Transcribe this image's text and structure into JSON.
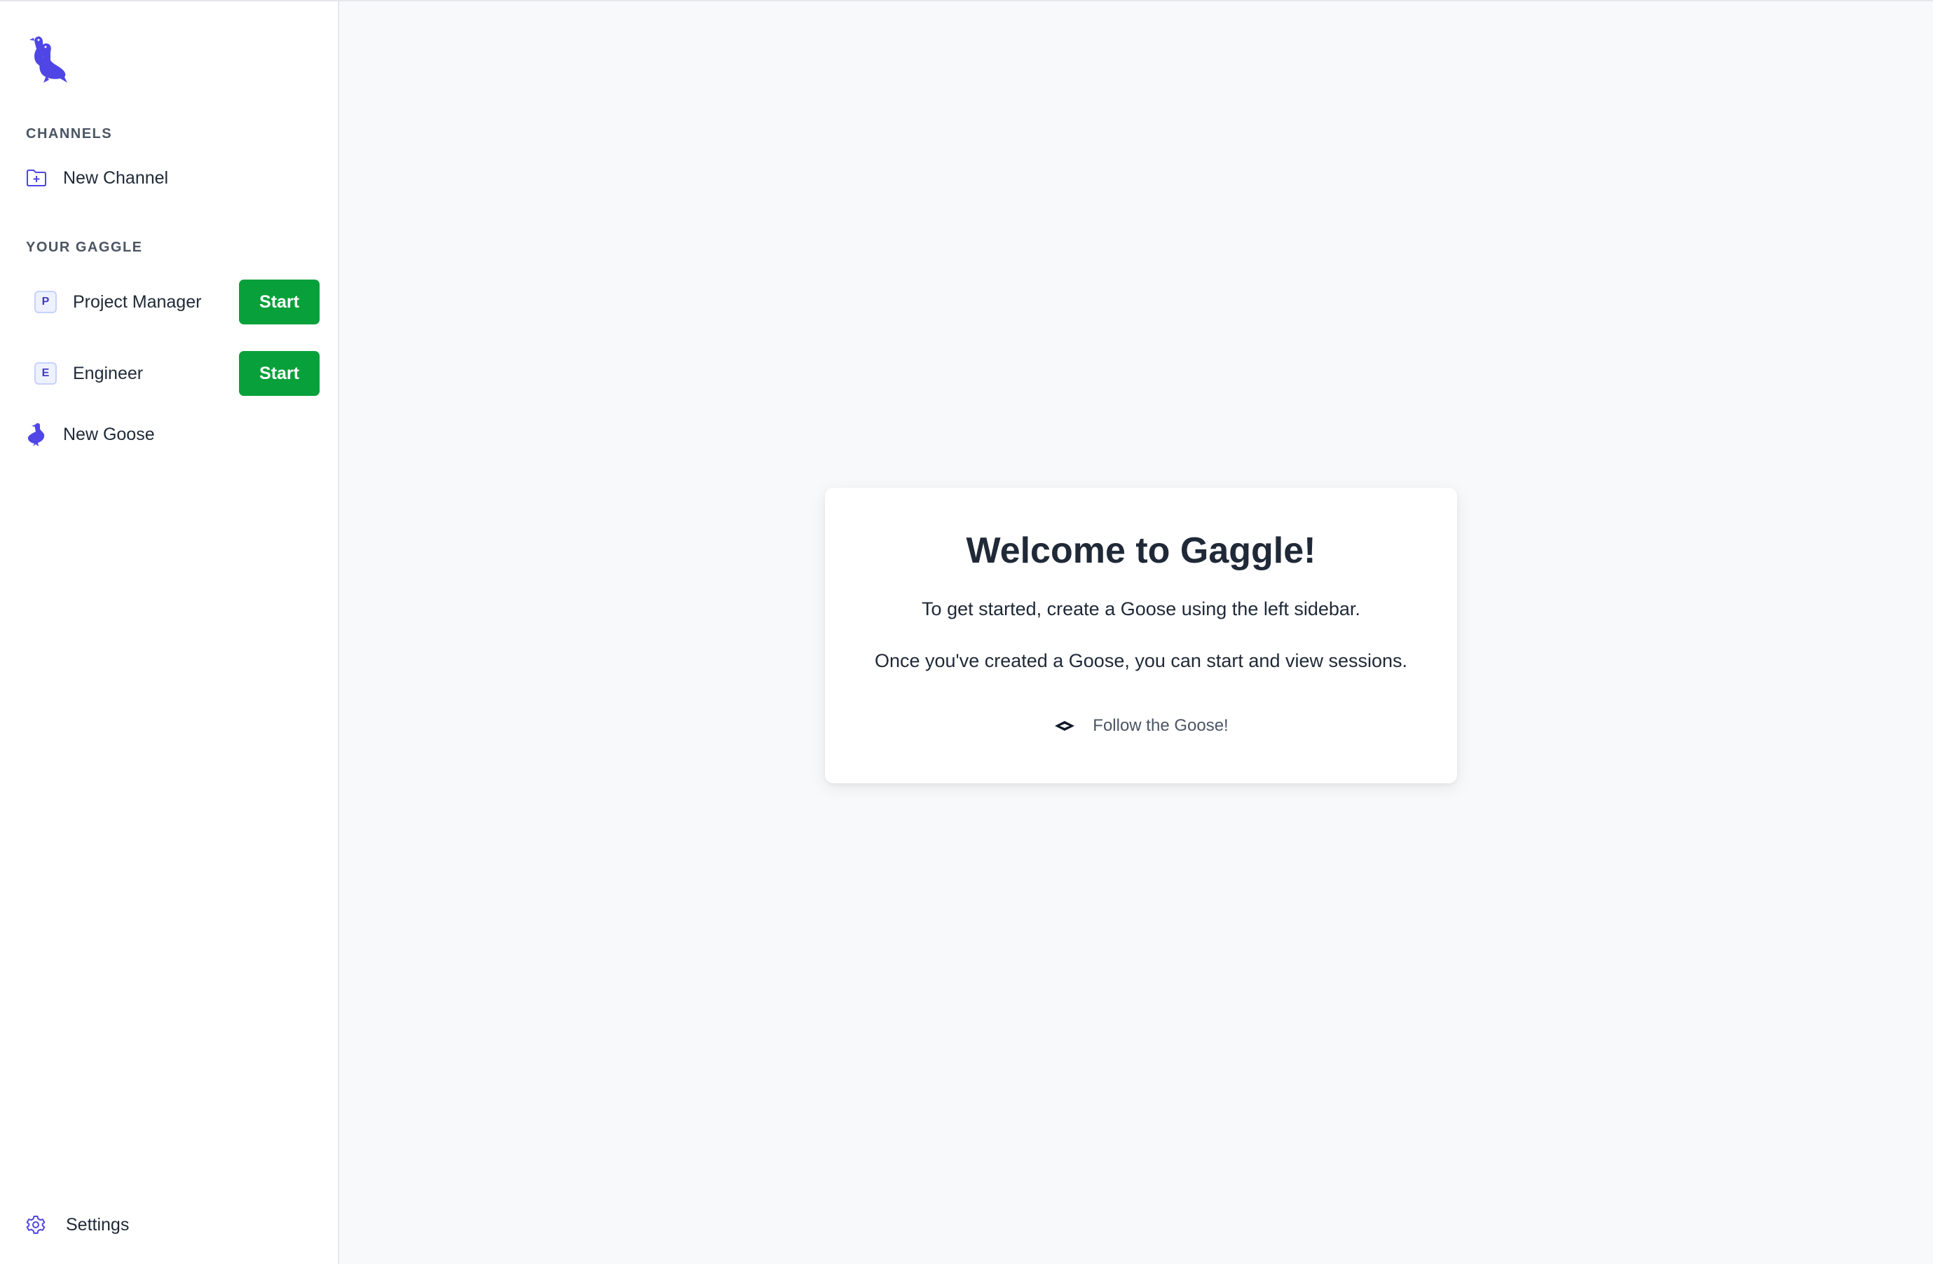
{
  "sidebar": {
    "channels_label": "CHANNELS",
    "new_channel_label": "New Channel",
    "gaggle_label": "YOUR GAGGLE",
    "gaggle": [
      {
        "initial": "P",
        "name": "Project Manager",
        "button": "Start"
      },
      {
        "initial": "E",
        "name": "Engineer",
        "button": "Start"
      }
    ],
    "new_goose_label": "New Goose",
    "settings_label": "Settings"
  },
  "welcome": {
    "title": "Welcome to Gaggle!",
    "line1": "To get started, create a Goose using the left sidebar.",
    "line2": "Once you've created a Goose, you can start and view sessions.",
    "follow_label": "Follow the Goose!"
  },
  "colors": {
    "accent": "#4f46e5",
    "start_button": "#08a03a",
    "background": "#f8f9fb"
  },
  "icons": {
    "logo": "gaggle-geese-logo",
    "new_channel": "folder-plus-icon",
    "new_goose": "goose-icon",
    "settings": "gear-icon",
    "follow": "diamond-arrows-icon"
  }
}
